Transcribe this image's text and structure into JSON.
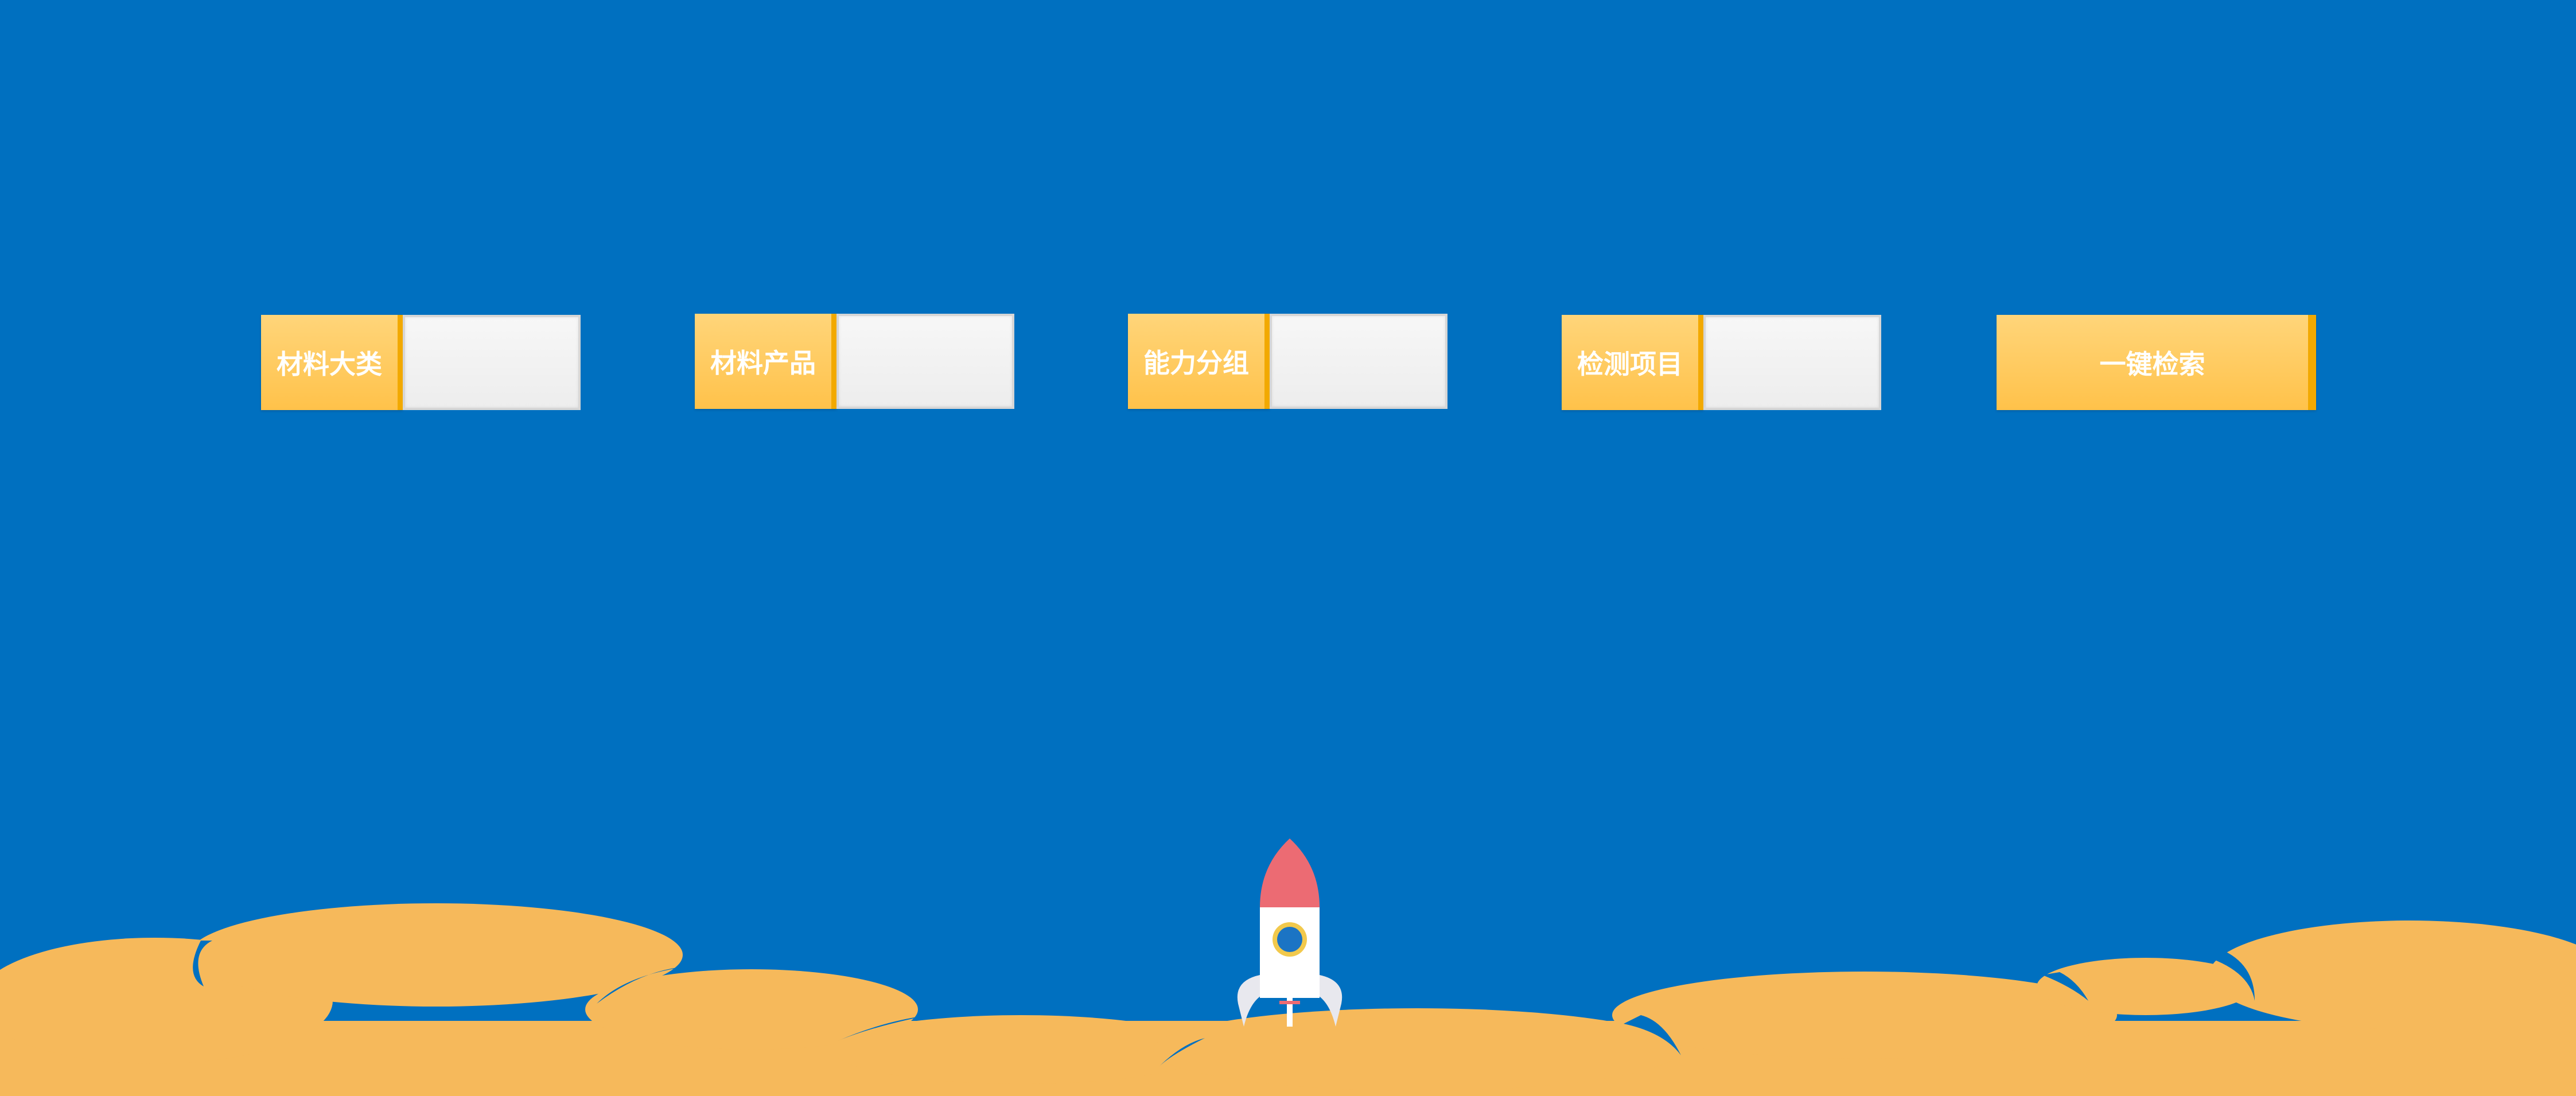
{
  "colors": {
    "background": "#0070C0",
    "accent": "#FFC24A",
    "accent_edge": "#F2A900",
    "cloud": "#F6B95B",
    "rocket_nose": "#EC6B73"
  },
  "filters": [
    {
      "label": "材料大类",
      "value": ""
    },
    {
      "label": "材料产品",
      "value": ""
    },
    {
      "label": "能力分组",
      "value": ""
    },
    {
      "label": "检测项目",
      "value": ""
    }
  ],
  "search_button": {
    "label": "一键检索"
  },
  "decor": {
    "clouds_icon": "clouds-icon",
    "rocket_icon": "rocket-icon"
  }
}
